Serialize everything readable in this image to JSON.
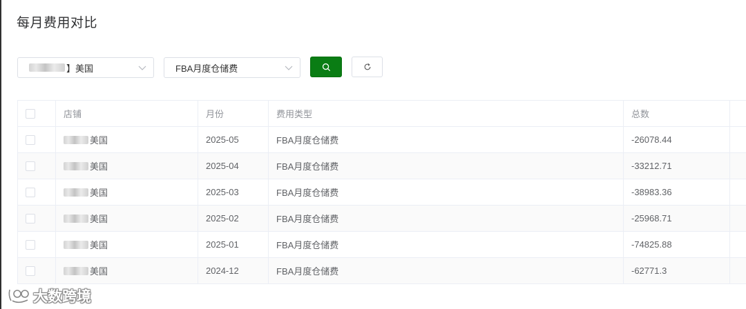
{
  "page": {
    "title": "每月费用对比"
  },
  "filters": {
    "store_select": {
      "value_suffix": "】美国"
    },
    "fee_type_select": {
      "value": "FBA月度仓储费"
    }
  },
  "table": {
    "headers": [
      "店铺",
      "月份",
      "费用类型",
      "总数"
    ],
    "rows": [
      {
        "store_suffix": "美国",
        "month": "2025-05",
        "fee_type": "FBA月度仓储费",
        "total": "-26078.44"
      },
      {
        "store_suffix": "美国",
        "month": "2025-04",
        "fee_type": "FBA月度仓储费",
        "total": "-33212.71"
      },
      {
        "store_suffix": "美国",
        "month": "2025-03",
        "fee_type": "FBA月度仓储费",
        "total": "-38983.36"
      },
      {
        "store_suffix": "美国",
        "month": "2025-02",
        "fee_type": "FBA月度仓储费",
        "total": "-25968.71"
      },
      {
        "store_suffix": "美国",
        "month": "2025-01",
        "fee_type": "FBA月度仓储费",
        "total": "-74825.88"
      },
      {
        "store_suffix": "美国",
        "month": "2024-12",
        "fee_type": "FBA月度仓储费",
        "total": "-62771.3"
      }
    ]
  },
  "watermark": {
    "text": "大数跨境"
  },
  "icons": {
    "search": "search-icon",
    "reset": "refresh-icon",
    "dropdown": "chevron-down-icon"
  },
  "colors": {
    "primary": "#0a7d14",
    "border": "#ebeef5",
    "header_text": "#909399"
  }
}
